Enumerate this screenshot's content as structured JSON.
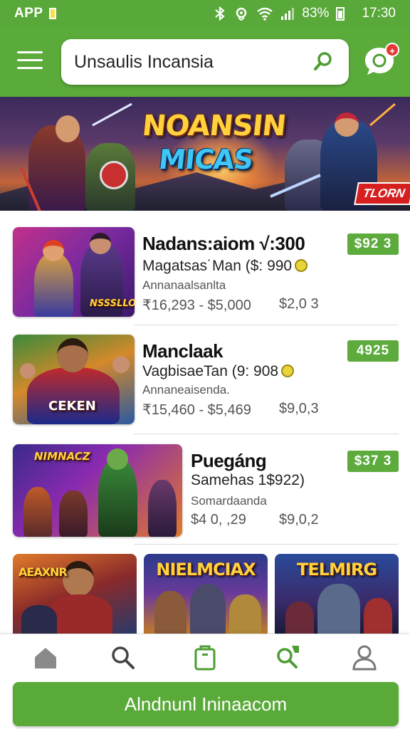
{
  "status_bar": {
    "carrier": "APP",
    "battery_percent": "83%",
    "time": "17:30",
    "icons": [
      "sim-icon",
      "bluetooth-icon",
      "location-icon",
      "wifi-icon",
      "signal-icon",
      "battery-icon"
    ]
  },
  "header": {
    "search": {
      "value": "Unsaulis Incansia"
    },
    "chat_badge": "+",
    "colors": {
      "brand_green": "#5bab3b",
      "badge_red": "#e53935"
    }
  },
  "banner": {
    "title_line1": "NOANSIN",
    "title_line2": "MICAS",
    "tag": "TLORN"
  },
  "listings": [
    {
      "title": "Nadans:aiom √:300",
      "subtitle": "Magatsas˙Man ($: 990",
      "meta": "Annanaalsanlta",
      "range": "₹16,293 - $5,000",
      "alt_price": "$2,0 3",
      "price_badge": "$92 3",
      "thumb_caption": "NSSSLLO"
    },
    {
      "title": "Manclaak",
      "subtitle": "VagbisaeTan (9: 908",
      "meta": "Annaneaisenda.",
      "range": "₹15,460 - $5,469",
      "alt_price": "$9,0,3",
      "price_badge": "4925",
      "thumb_caption": "CEKEN"
    },
    {
      "title": "Puegáng",
      "subtitle": "Samehas  1$922)",
      "meta": "Somardaanda",
      "range": "$4 0, ,29",
      "alt_price": "$9,0,2",
      "price_badge": "$37 3",
      "thumb_caption": "NIMNACZ"
    }
  ],
  "grid_tiles": [
    {
      "caption": "AEAXNR"
    },
    {
      "caption": "NIELMCIAX"
    },
    {
      "caption": "TELMIRG"
    }
  ],
  "bottom_nav": [
    {
      "name": "home",
      "icon": "home-icon"
    },
    {
      "name": "search",
      "icon": "search-icon"
    },
    {
      "name": "bag",
      "icon": "shopping-bag-icon"
    },
    {
      "name": "discover",
      "icon": "magnify-tag-icon"
    },
    {
      "name": "profile",
      "icon": "profile-icon"
    }
  ],
  "cta": {
    "label": "Alndnunl Ininaacom"
  }
}
